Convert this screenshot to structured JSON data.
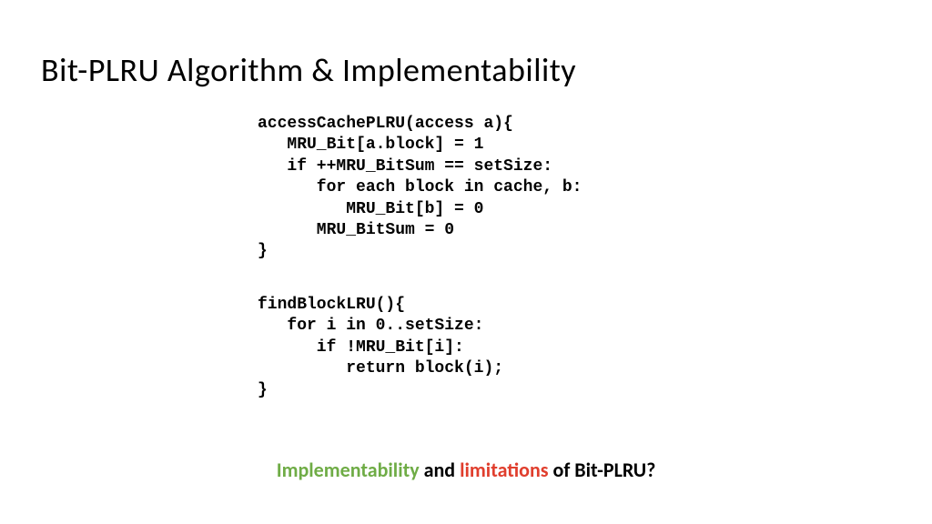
{
  "title": "Bit-PLRU Algorithm & Implementability",
  "code_block_1": "accessCachePLRU(access a){\n   MRU_Bit[a.block] = 1\n   if ++MRU_BitSum == setSize:\n      for each block in cache, b:\n         MRU_Bit[b] = 0\n      MRU_BitSum = 0\n}",
  "code_block_2": "findBlockLRU(){\n   for i in 0..setSize:\n      if !MRU_Bit[i]:\n         return block(i);\n}",
  "question": {
    "word1": "Implementability",
    "conj1": " and ",
    "word2": "limitations",
    "rest": " of Bit-PLRU?"
  }
}
